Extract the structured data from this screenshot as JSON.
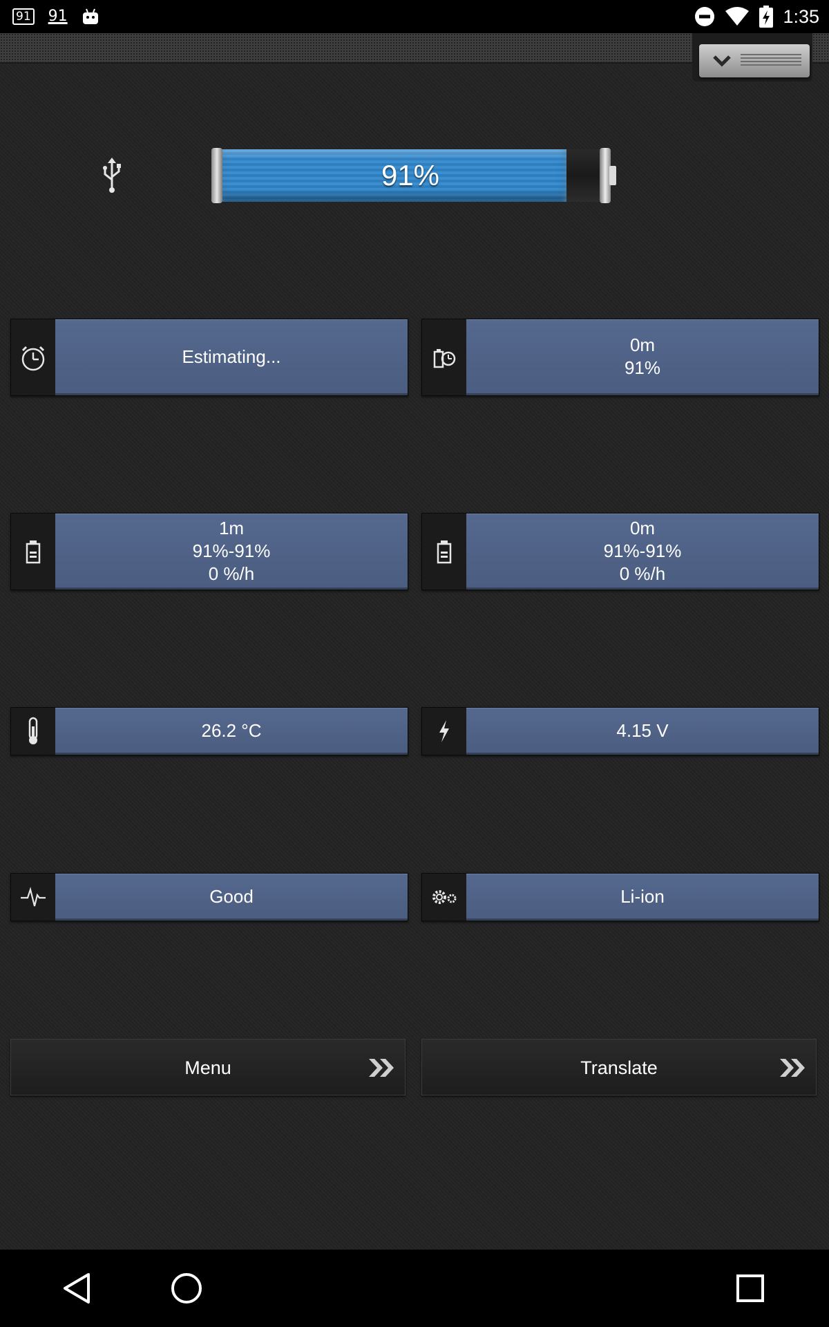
{
  "status_bar": {
    "notif_1": "91",
    "notif_2": "91",
    "time": "1:35"
  },
  "battery": {
    "level_percent": 91,
    "label": "91%",
    "fill_color": "#3b8fd0",
    "charging_source_icon": "usb-icon"
  },
  "tiles": {
    "time_remaining": {
      "icon": "stopwatch-icon",
      "lines": [
        "Estimating..."
      ]
    },
    "since_unplugged": {
      "icon": "battery-timer-icon",
      "lines": [
        "0m",
        "91%"
      ]
    },
    "session_1": {
      "icon": "battery-icon",
      "lines": [
        "1m",
        "91%-91%",
        "0 %/h"
      ]
    },
    "session_2": {
      "icon": "battery-icon",
      "lines": [
        "0m",
        "91%-91%",
        "0 %/h"
      ]
    },
    "temperature": {
      "icon": "thermometer-icon",
      "lines": [
        "26.2 °C"
      ]
    },
    "voltage": {
      "icon": "lightning-icon",
      "lines": [
        "4.15 V"
      ]
    },
    "health": {
      "icon": "pulse-icon",
      "lines": [
        "Good"
      ]
    },
    "technology": {
      "icon": "gears-icon",
      "lines": [
        "Li-ion"
      ]
    }
  },
  "buttons": {
    "menu_label": "Menu",
    "translate_label": "Translate"
  },
  "colors": {
    "tile_value_bg": "#55688e",
    "background": "#232323"
  }
}
